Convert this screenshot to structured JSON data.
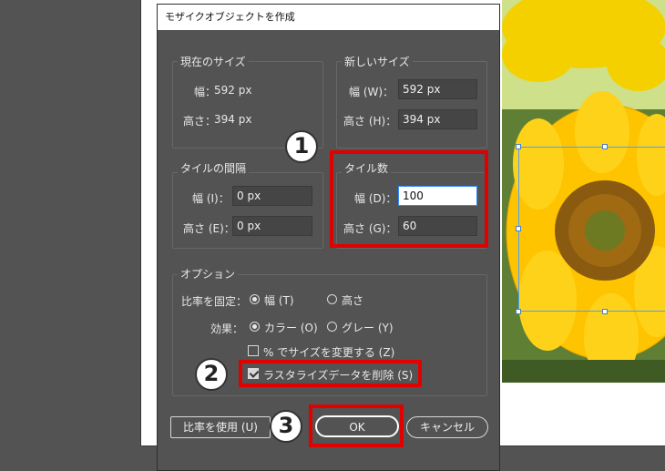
{
  "dialog": {
    "title": "モザイクオブジェクトを作成",
    "current_size": {
      "legend": "現在のサイズ",
      "width_label": "幅：",
      "width_value": "592 px",
      "height_label": "高さ：",
      "height_value": "394 px"
    },
    "new_size": {
      "legend": "新しいサイズ",
      "width_label": "幅 (W)：",
      "width_value": "592 px",
      "height_label": "高さ (H)：",
      "height_value": "394 px"
    },
    "tile_spacing": {
      "legend": "タイルの間隔",
      "width_label": "幅 (I)：",
      "width_value": "0 px",
      "height_label": "高さ (E)：",
      "height_value": "0 px"
    },
    "tile_count": {
      "legend": "タイル数",
      "width_label": "幅 (D)：",
      "width_value": "100",
      "height_label": "高さ (G)：",
      "height_value": "60"
    },
    "options": {
      "legend": "オプション",
      "ratio_label": "比率を固定：",
      "ratio_width": "幅 (T)",
      "ratio_height": "高さ",
      "effect_label": "効果：",
      "effect_color": "カラー (O)",
      "effect_gray": "グレー (Y)",
      "percent_resize": "% でサイズを変更する (Z)",
      "delete_raster": "ラスタライズデータを削除 (S)"
    },
    "buttons": {
      "use_ratio": "比率を使用 (U)",
      "ok": "OK",
      "cancel": "キャンセル"
    }
  },
  "callouts": [
    "1",
    "2",
    "3"
  ],
  "colors": {
    "highlight": "#e00000",
    "panel_bg": "#535353",
    "selection": "#4aa0ff"
  }
}
